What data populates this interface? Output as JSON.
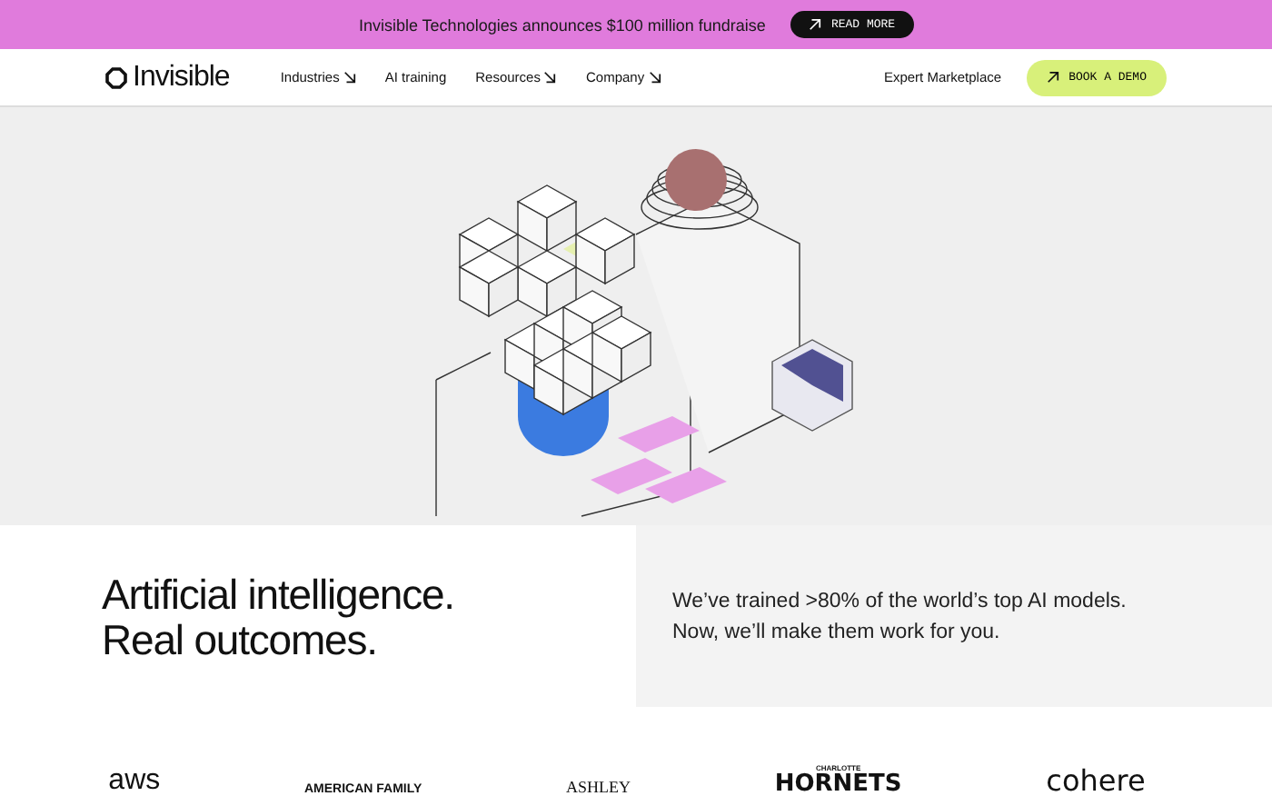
{
  "announcement": {
    "text": "Invisible Technologies announces $100 million fundraise",
    "button": "READ MORE"
  },
  "nav": {
    "brand": "Invisible",
    "items": [
      {
        "label": "Industries",
        "has_menu": true
      },
      {
        "label": "AI training",
        "has_menu": false
      },
      {
        "label": "Resources",
        "has_menu": true
      },
      {
        "label": "Company",
        "has_menu": true
      }
    ],
    "link": "Expert Marketplace",
    "cta": "BOOK A DEMO"
  },
  "hero": {
    "headline": [
      "Artificial intelligence.",
      "Real outcomes."
    ],
    "summary": [
      "We’ve trained >80% of the world’s top AI models.",
      "Now, we’ll make them work for you."
    ]
  },
  "logos": [
    {
      "kind": "aws",
      "text": "aws"
    },
    {
      "kind": "family",
      "text": "AMERICAN FAMILY"
    },
    {
      "kind": "ashley",
      "text": "ASHLEY"
    },
    {
      "kind": "hornets",
      "text": "HORNETS",
      "small": "CHARLOTTE"
    },
    {
      "kind": "cohere",
      "text": "cohere"
    }
  ]
}
